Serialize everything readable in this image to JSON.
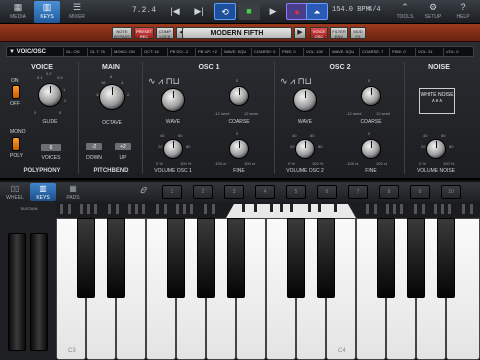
{
  "toolbar": {
    "media": "MEDIA",
    "keys": "KEYS",
    "mixer": "MIXER",
    "position": "7.2.4",
    "bpm": "154.0 BPM",
    "signature": "4/4",
    "tools": "TOOLS",
    "setup": "SETUP",
    "help": "HELP"
  },
  "preset_bar": {
    "note_bypass": "NOTE BYPASS",
    "preset_rec": "PRESET REC",
    "compare_lock": "COMP LOCK",
    "name": "MODERN FIFTH",
    "voice_osc": "VOICE OSC",
    "filter_env": "FILTER ENV",
    "mod_fx": "MOD FX"
  },
  "tabrow": {
    "section": "VOIC/OSC",
    "params": [
      "GL: ON",
      "GL T: 76",
      "MONO: ON",
      "OCT: 16",
      "PB DO: -2",
      "PB UP: +2",
      "WAVE: SQU",
      "COARSE: 0",
      "FINE: 0",
      "VOL: 100",
      "WAVE: SQU",
      "COARSE: 7",
      "FINE: 0",
      "VOL: 51",
      "VOL: 0"
    ]
  },
  "voice": {
    "header": "VOICE",
    "on": "ON",
    "off": "OFF",
    "glide": "GLIDE",
    "glide_ticks": [
      "0.1",
      "0.2",
      "0.5",
      "1",
      "2",
      "5",
      "0"
    ],
    "mono": "MONO",
    "poly": "POLY",
    "voices": "VOICES",
    "voices_value": "6",
    "polyphony": "POLYPHONY"
  },
  "main": {
    "header": "MAIN",
    "octave": "OCTAVE",
    "octave_ticks": [
      "32",
      "16",
      "8",
      "4",
      "2"
    ],
    "down_value": "-2",
    "up_value": "+2",
    "down": "DOWN",
    "up": "UP",
    "pitchbend": "PITCHBEND"
  },
  "osc1": {
    "header": "OSC 1",
    "wave": "WAVE",
    "coarse": "COARSE",
    "coarse_min": "-12 semi",
    "coarse_max": "12 semi",
    "coarse_zero": "0",
    "volume": "VOLUME OSC 1",
    "fine": "FINE",
    "fine_min": "-100 ct",
    "fine_max": "100 ct",
    "fine_zero": "0",
    "vol_ticks": [
      "0 %",
      "20",
      "40",
      "60",
      "80",
      "100 %"
    ]
  },
  "osc2": {
    "header": "OSC 2",
    "wave": "WAVE",
    "coarse": "COARSE",
    "coarse_min": "-12 semi",
    "coarse_max": "12 semi",
    "coarse_zero": "0",
    "volume": "VOLUME OSC 2",
    "fine": "FINE",
    "fine_min": "-100 ct",
    "fine_max": "100 ct",
    "fine_zero": "0",
    "vol_ticks": [
      "0 %",
      "20",
      "40",
      "60",
      "80",
      "100 %"
    ]
  },
  "noise": {
    "header": "NOISE",
    "white_noise": "WHITE NOISE",
    "volume": "VOLUME NOISE",
    "vol_ticks": [
      "0 %",
      "20",
      "40",
      "60",
      "80",
      "100 %"
    ]
  },
  "keyboard_controls": {
    "wheel": "WHEEL",
    "keys": "KEYS",
    "pads": "PADS",
    "octaves": [
      "1",
      "2",
      "3",
      "4",
      "5",
      "6",
      "7",
      "8",
      "9",
      "10"
    ],
    "sustain": "SUSTAIN",
    "c3": "C3",
    "c4": "C4"
  }
}
